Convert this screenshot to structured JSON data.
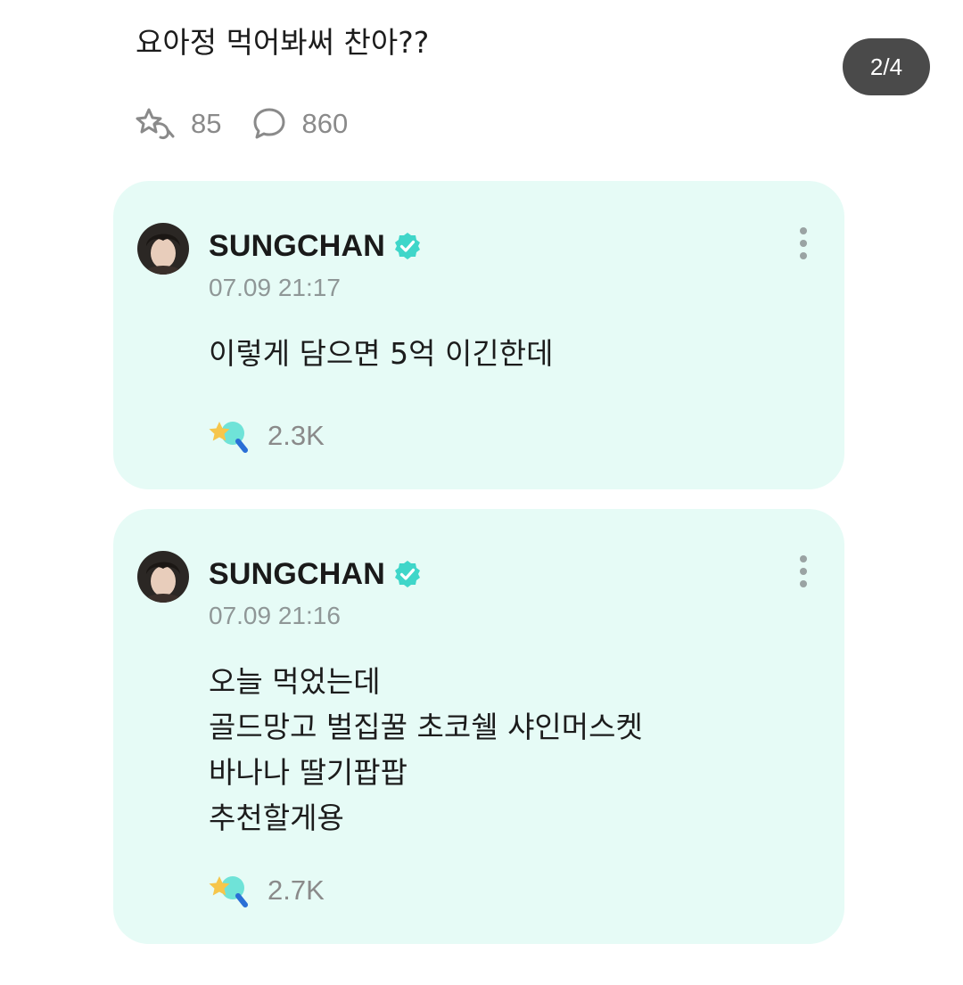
{
  "post": {
    "text": "요아정 먹어봐써 찬아??",
    "page_counter": "2/4",
    "reaction_count": "85",
    "comment_count": "860"
  },
  "comments": [
    {
      "author": "SUNGCHAN",
      "verified": true,
      "timestamp": "07.09 21:17",
      "text": "이렇게 담으면 5억 이긴한데",
      "reaction_count": "2.3K"
    },
    {
      "author": "SUNGCHAN",
      "verified": true,
      "timestamp": "07.09 21:16",
      "text": "오늘 먹었는데\n골드망고 벌집꿀 초코쉘 샤인머스켓\n바나나 딸기팝팝\n추천할게용",
      "reaction_count": "2.7K"
    }
  ],
  "colors": {
    "card_background": "#e6fbf6",
    "verified_badge": "#3fd6c9",
    "page_counter_background": "#4a4a4a",
    "muted_text": "#8a8a8a"
  },
  "icons": {
    "post_reaction": "star-sparkle-outline-icon",
    "post_comment": "speech-bubble-icon",
    "comment_reaction": "star-lollipop-icon",
    "verified": "verified-badge-icon",
    "more": "more-vertical-icon"
  }
}
